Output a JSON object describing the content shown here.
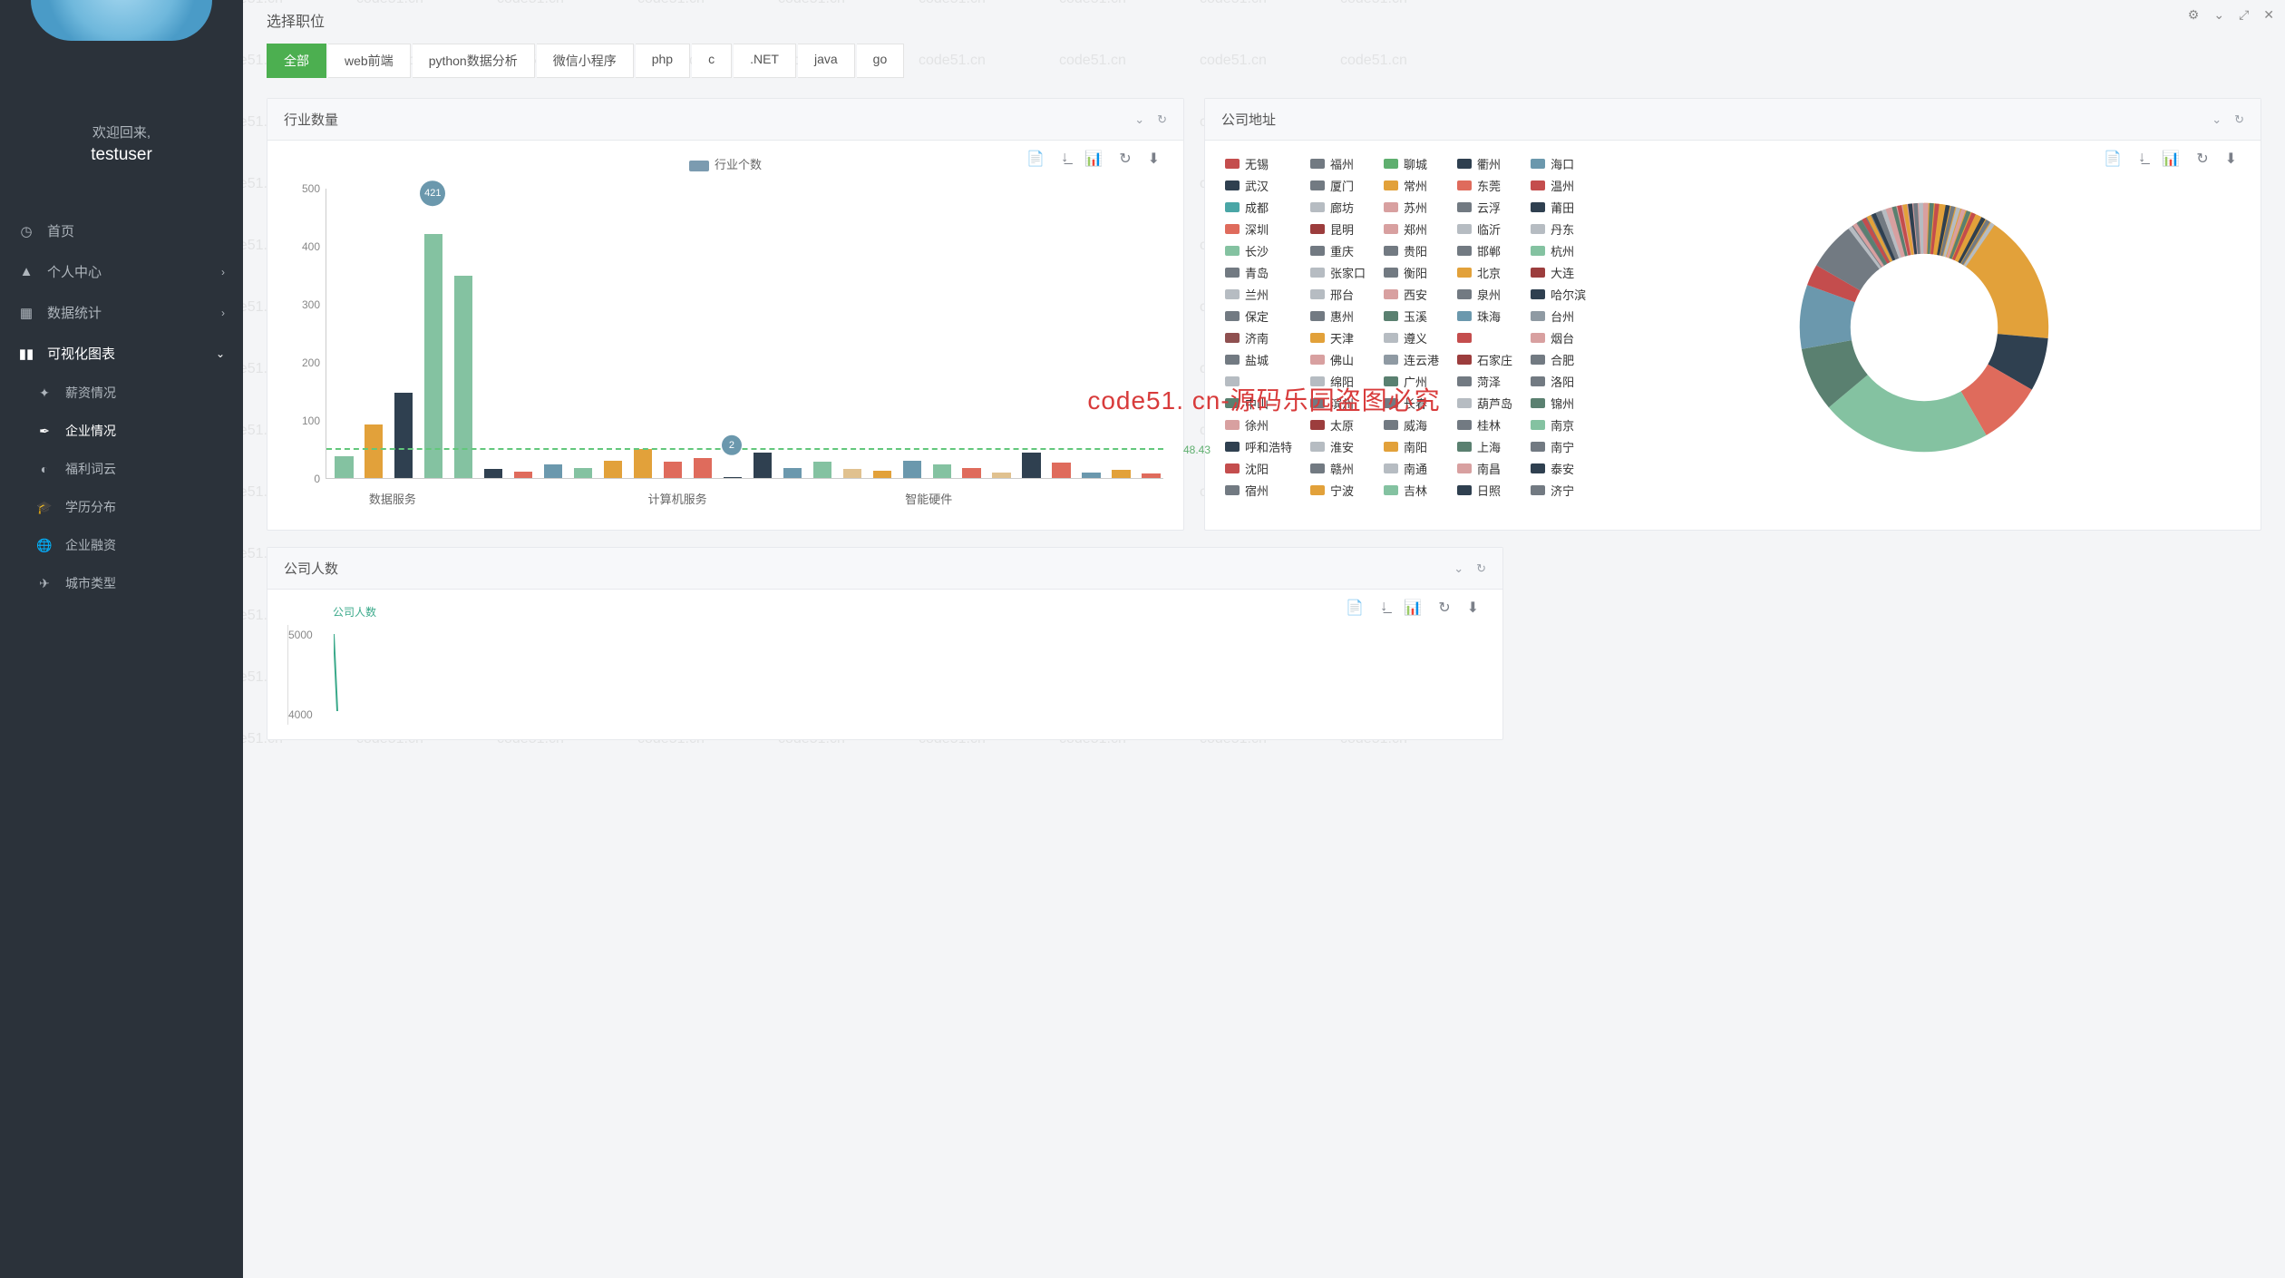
{
  "sidebar": {
    "welcome": "欢迎回来,",
    "username": "testuser",
    "nav": [
      {
        "icon": "dashboard",
        "label": "首页",
        "expandable": false
      },
      {
        "icon": "person",
        "label": "个人中心",
        "expandable": true,
        "expanded": false
      },
      {
        "icon": "grid",
        "label": "数据统计",
        "expandable": true,
        "expanded": false
      },
      {
        "icon": "bars",
        "label": "可视化图表",
        "expandable": true,
        "expanded": true,
        "active": true,
        "children": [
          {
            "icon": "sparkle",
            "label": "薪资情况"
          },
          {
            "icon": "feather",
            "label": "企业情况",
            "active": true
          },
          {
            "icon": "bulb",
            "label": "福利词云"
          },
          {
            "icon": "cap",
            "label": "学历分布"
          },
          {
            "icon": "globe",
            "label": "企业融资"
          },
          {
            "icon": "rocket",
            "label": "城市类型"
          }
        ]
      }
    ]
  },
  "toolbar": {
    "t1": "⚙",
    "t2": "⌄",
    "t3": "⤢",
    "t4": "✕"
  },
  "section": {
    "title": "选择职位"
  },
  "job_tabs": [
    "全部",
    "web前端",
    "python数据分析",
    "微信小程序",
    "php",
    "c",
    ".NET",
    "java",
    "go"
  ],
  "active_job_tab": 0,
  "panels": {
    "industry": {
      "title": "行业数量",
      "legend": "行业个数"
    },
    "address": {
      "title": "公司地址"
    },
    "headcount": {
      "title": "公司人数",
      "legend": "公司人数"
    }
  },
  "chart_icons": {
    "i1": "📄",
    "i2": "↓̲",
    "i3": "📊",
    "i4": "↻",
    "i5": "⬇"
  },
  "panel_ops": {
    "collapse": "⌄",
    "refresh": "↻"
  },
  "center_watermark": "code51. cn-源码乐园盗图必究",
  "watermark_text": "code51.cn",
  "chart_data": [
    {
      "id": "industry_bar",
      "type": "bar",
      "title": "行业数量",
      "ylabel": "",
      "xlabel": "",
      "ylim": [
        0,
        500
      ],
      "yticks": [
        0,
        100,
        200,
        300,
        400,
        500
      ],
      "categories_shown": [
        "数据服务",
        "计算机服务",
        "智能硬件"
      ],
      "series": [
        {
          "name": "行业个数",
          "color": "#7b9bb0"
        }
      ],
      "callouts": [
        {
          "index": 3,
          "value": 421
        },
        {
          "index": 13,
          "value": 2
        }
      ],
      "average_line": 48.43,
      "bars": [
        {
          "v": 38,
          "c": "#84c2a1"
        },
        {
          "v": 92,
          "c": "#e2a13a"
        },
        {
          "v": 148,
          "c": "#2f4050"
        },
        {
          "v": 421,
          "c": "#84c2a1"
        },
        {
          "v": 350,
          "c": "#84c2a1"
        },
        {
          "v": 16,
          "c": "#2f4050"
        },
        {
          "v": 11,
          "c": "#df6b5c"
        },
        {
          "v": 24,
          "c": "#6b98ad"
        },
        {
          "v": 18,
          "c": "#84c2a1"
        },
        {
          "v": 30,
          "c": "#e2a13a"
        },
        {
          "v": 50,
          "c": "#e2a13a"
        },
        {
          "v": 28,
          "c": "#df6b5c"
        },
        {
          "v": 34,
          "c": "#df6b5c"
        },
        {
          "v": 2,
          "c": "#2f4050"
        },
        {
          "v": 44,
          "c": "#2f4050"
        },
        {
          "v": 18,
          "c": "#6b98ad"
        },
        {
          "v": 28,
          "c": "#84c2a1"
        },
        {
          "v": 16,
          "c": "#e0c18f"
        },
        {
          "v": 12,
          "c": "#e2a13a"
        },
        {
          "v": 30,
          "c": "#6b98ad"
        },
        {
          "v": 24,
          "c": "#84c2a1"
        },
        {
          "v": 18,
          "c": "#df6b5c"
        },
        {
          "v": 10,
          "c": "#e0c18f"
        },
        {
          "v": 44,
          "c": "#2f4050"
        },
        {
          "v": 26,
          "c": "#df6b5c"
        },
        {
          "v": 10,
          "c": "#6b98ad"
        },
        {
          "v": 14,
          "c": "#e2a13a"
        },
        {
          "v": 8,
          "c": "#df6b5c"
        }
      ]
    },
    {
      "id": "company_address_donut",
      "type": "pie",
      "title": "公司地址",
      "legend": [
        {
          "n": "无锡",
          "c": "#c44d4d"
        },
        {
          "n": "福州",
          "c": "#727a82"
        },
        {
          "n": "聊城",
          "c": "#5faf6f"
        },
        {
          "n": "衢州",
          "c": "#2f4050"
        },
        {
          "n": "海口",
          "c": "#6b98ad"
        },
        {
          "n": "武汉",
          "c": "#2f4050"
        },
        {
          "n": "厦门",
          "c": "#727a82"
        },
        {
          "n": "常州",
          "c": "#e2a13a"
        },
        {
          "n": "东莞",
          "c": "#df6b5c"
        },
        {
          "n": "温州",
          "c": "#c44d4d"
        },
        {
          "n": "成都",
          "c": "#4aa6a6"
        },
        {
          "n": "廊坊",
          "c": "#b6bcc2"
        },
        {
          "n": "苏州",
          "c": "#d8a0a0"
        },
        {
          "n": "云浮",
          "c": "#727a82"
        },
        {
          "n": "莆田",
          "c": "#2f4050"
        },
        {
          "n": "深圳",
          "c": "#df6b5c"
        },
        {
          "n": "昆明",
          "c": "#9c3d3d"
        },
        {
          "n": "郑州",
          "c": "#d8a0a0"
        },
        {
          "n": "临沂",
          "c": "#b6bcc2"
        },
        {
          "n": "丹东",
          "c": "#b6bcc2"
        },
        {
          "n": "长沙",
          "c": "#84c2a1"
        },
        {
          "n": "重庆",
          "c": "#727a82"
        },
        {
          "n": "贵阳",
          "c": "#727a82"
        },
        {
          "n": "邯郸",
          "c": "#727a82"
        },
        {
          "n": "杭州",
          "c": "#84c2a1"
        },
        {
          "n": "青岛",
          "c": "#727a82"
        },
        {
          "n": "张家口",
          "c": "#b6bcc2"
        },
        {
          "n": "衡阳",
          "c": "#727a82"
        },
        {
          "n": "北京",
          "c": "#e2a13a"
        },
        {
          "n": "大连",
          "c": "#9c3d3d"
        },
        {
          "n": "兰州",
          "c": "#b6bcc2"
        },
        {
          "n": "邢台",
          "c": "#b6bcc2"
        },
        {
          "n": "西安",
          "c": "#d8a0a0"
        },
        {
          "n": "泉州",
          "c": "#727a82"
        },
        {
          "n": "哈尔滨",
          "c": "#2f4050"
        },
        {
          "n": "保定",
          "c": "#727a82"
        },
        {
          "n": "惠州",
          "c": "#727a82"
        },
        {
          "n": "玉溪",
          "c": "#5a8070"
        },
        {
          "n": "珠海",
          "c": "#6b98ad"
        },
        {
          "n": "台州",
          "c": "#8f9aa3"
        },
        {
          "n": "济南",
          "c": "#8f5050"
        },
        {
          "n": "天津",
          "c": "#e2a13a"
        },
        {
          "n": "遵义",
          "c": "#b6bcc2"
        },
        {
          "n": "",
          "c": "#c44d4d"
        },
        {
          "n": "烟台",
          "c": "#d8a0a0"
        },
        {
          "n": "盐城",
          "c": "#727a82"
        },
        {
          "n": "佛山",
          "c": "#d8a0a0"
        },
        {
          "n": "连云港",
          "c": "#8f9aa3"
        },
        {
          "n": "石家庄",
          "c": "#9c3d3d"
        },
        {
          "n": "合肥",
          "c": "#727a82"
        },
        {
          "n": "",
          "c": "#b6bcc2"
        },
        {
          "n": "绵阳",
          "c": "#b6bcc2"
        },
        {
          "n": "广州",
          "c": "#5a8070"
        },
        {
          "n": "菏泽",
          "c": "#727a82"
        },
        {
          "n": "洛阳",
          "c": "#727a82"
        },
        {
          "n": "中山",
          "c": "#5a8070"
        },
        {
          "n": "滨州",
          "c": "#727a82"
        },
        {
          "n": "长春",
          "c": "#727a82"
        },
        {
          "n": "葫芦岛",
          "c": "#b6bcc2"
        },
        {
          "n": "锦州",
          "c": "#5a8070"
        },
        {
          "n": "徐州",
          "c": "#d8a0a0"
        },
        {
          "n": "太原",
          "c": "#9c3d3d"
        },
        {
          "n": "威海",
          "c": "#727a82"
        },
        {
          "n": "桂林",
          "c": "#727a82"
        },
        {
          "n": "南京",
          "c": "#84c2a1"
        },
        {
          "n": "呼和浩特",
          "c": "#2f4050"
        },
        {
          "n": "淮安",
          "c": "#b6bcc2"
        },
        {
          "n": "南阳",
          "c": "#e2a13a"
        },
        {
          "n": "上海",
          "c": "#5a8070"
        },
        {
          "n": "南宁",
          "c": "#727a82"
        },
        {
          "n": "沈阳",
          "c": "#c44d4d"
        },
        {
          "n": "赣州",
          "c": "#727a82"
        },
        {
          "n": "南通",
          "c": "#b6bcc2"
        },
        {
          "n": "南昌",
          "c": "#d8a0a0"
        },
        {
          "n": "泰安",
          "c": "#2f4050"
        },
        {
          "n": "宿州",
          "c": "#727a82"
        },
        {
          "n": "宁波",
          "c": "#e2a13a"
        },
        {
          "n": "吉林",
          "c": "#84c2a1"
        },
        {
          "n": "日照",
          "c": "#2f4050"
        },
        {
          "n": "济宁",
          "c": "#727a82"
        }
      ]
    },
    {
      "id": "company_headcount_line",
      "type": "line",
      "title": "公司人数",
      "series": [
        {
          "name": "公司人数",
          "color": "#3aa98a"
        }
      ],
      "yticks_visible": [
        5000,
        4000
      ],
      "ylim": [
        0,
        5000
      ]
    }
  ]
}
